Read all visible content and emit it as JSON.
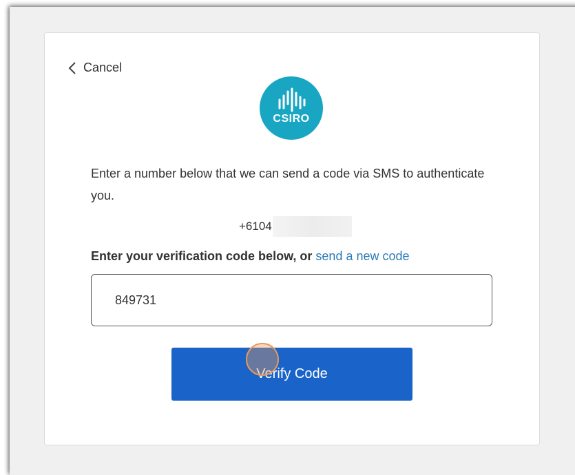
{
  "header": {
    "cancel_label": "Cancel"
  },
  "logo": {
    "text": "CSIRO"
  },
  "instructions": {
    "text": "Enter a number below that we can send a code via SMS to authenticate you."
  },
  "phone": {
    "visible_prefix": "+6104"
  },
  "verification": {
    "label": "Enter your verification code below, or",
    "link": "send a new code",
    "code_value": "849731"
  },
  "actions": {
    "verify_label": "Verify Code"
  },
  "colors": {
    "logo_bg": "#18a6c3",
    "button_bg": "#1a63c9",
    "link": "#2a7bb5"
  }
}
